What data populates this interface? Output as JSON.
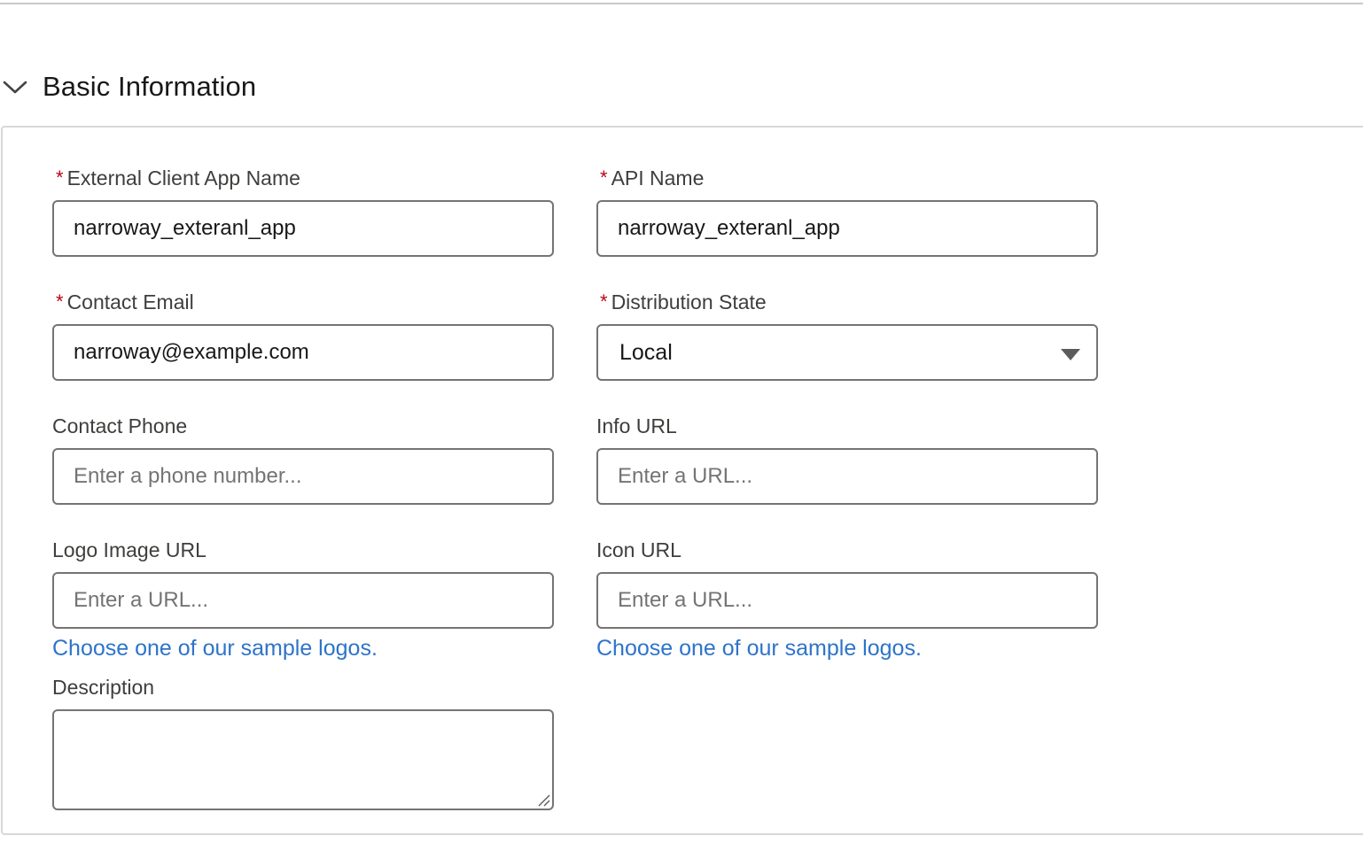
{
  "section": {
    "title": "Basic Information",
    "icon": "chevron-down-icon"
  },
  "colors": {
    "required": "#ba0517",
    "link": "#2e74c9",
    "border": "#747474"
  },
  "fields": {
    "app_name": {
      "label": "External Client App Name",
      "required_mark": "*",
      "value": "narroway_exteranl_app"
    },
    "api_name": {
      "label": "API Name",
      "required_mark": "*",
      "value": "narroway_exteranl_app"
    },
    "contact_email": {
      "label": "Contact Email",
      "required_mark": "*",
      "value": "narroway@example.com"
    },
    "distribution_state": {
      "label": "Distribution State",
      "required_mark": "*",
      "selected": "Local"
    },
    "contact_phone": {
      "label": "Contact Phone",
      "placeholder": "Enter a phone number..."
    },
    "info_url": {
      "label": "Info URL",
      "placeholder": "Enter a URL..."
    },
    "logo_image_url": {
      "label": "Logo Image URL",
      "placeholder": "Enter a URL...",
      "link": "Choose one of our sample logos."
    },
    "icon_url": {
      "label": "Icon URL",
      "placeholder": "Enter a URL...",
      "link": "Choose one of our sample logos."
    },
    "description": {
      "label": "Description",
      "value": ""
    }
  }
}
